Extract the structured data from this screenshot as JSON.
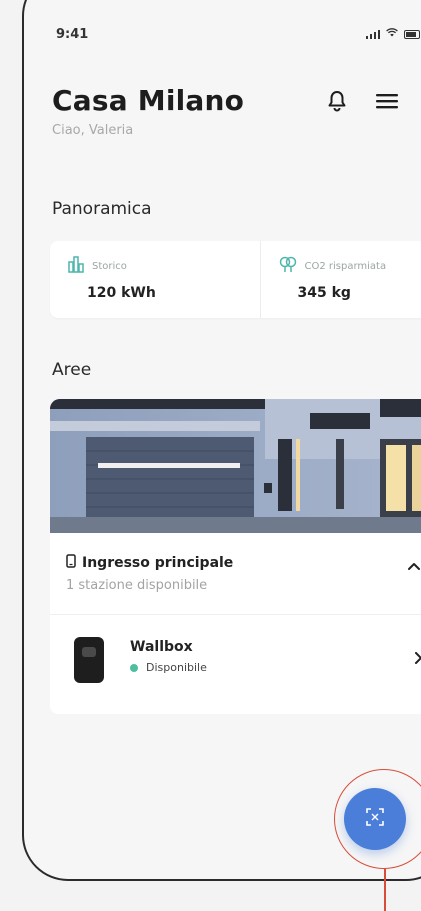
{
  "status_bar": {
    "time": "9:41"
  },
  "header": {
    "title": "Casa Milano",
    "greeting": "Ciao, Valeria",
    "icons": [
      "bell-icon",
      "menu-icon"
    ]
  },
  "overview": {
    "section_title": "Panoramica",
    "items": [
      {
        "icon": "building-chart-icon",
        "label": "Storico",
        "value": "120 kWh"
      },
      {
        "icon": "tree-icon",
        "label": "CO2 risparmiata",
        "value": "345 kg"
      }
    ]
  },
  "areas": {
    "section_title": "Aree",
    "list": [
      {
        "name": "Ingresso principale",
        "subtitle": "1 stazione disponibile",
        "stations": [
          {
            "name": "Wallbox",
            "status": "Disponibile"
          }
        ]
      }
    ]
  },
  "fab": {
    "icon": "scan-icon"
  },
  "colors": {
    "accent": "#4a7ed8",
    "status_available": "#4dbfa0",
    "callout": "#d84d3a",
    "icon_teal": "#4db6ac"
  }
}
